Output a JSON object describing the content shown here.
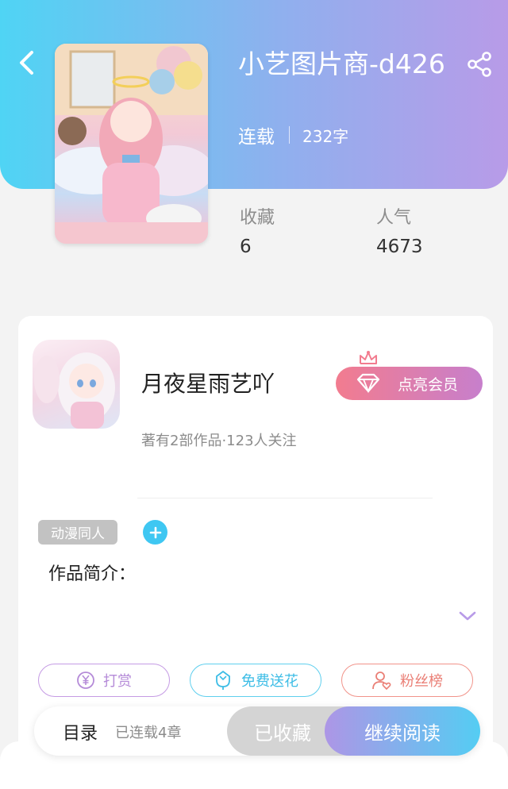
{
  "header": {
    "title": "小艺图片商-d426",
    "status": "连载",
    "word_count": "232字",
    "back_icon": "chevron-left-icon",
    "share_icon": "share-icon"
  },
  "stats": {
    "favorites_label": "收藏",
    "favorites_value": "6",
    "popularity_label": "人气",
    "popularity_value": "4673"
  },
  "author": {
    "name": "月夜星雨艺吖",
    "meta": "著有2部作品·123人关注",
    "vip_button_label": "点亮会员"
  },
  "work": {
    "tag": "动漫同人",
    "intro_label": "作品简介："
  },
  "actions": {
    "reward_label": "打赏",
    "flower_label": "免费送花",
    "fans_label": "粉丝榜"
  },
  "bottom_bar": {
    "toc_label": "目录",
    "toc_chapters": "已连载4章",
    "collected_label": "已收藏",
    "read_label": "继续阅读"
  },
  "colors": {
    "header_gradient_start": "#4fd4f4",
    "header_gradient_end": "#b89be8",
    "vip_gradient_start": "#f27c8f",
    "vip_gradient_end": "#c77fcc",
    "accent_blue": "#3fc7f2",
    "reward_purple": "#c59be4",
    "fans_red": "#f1938a"
  }
}
